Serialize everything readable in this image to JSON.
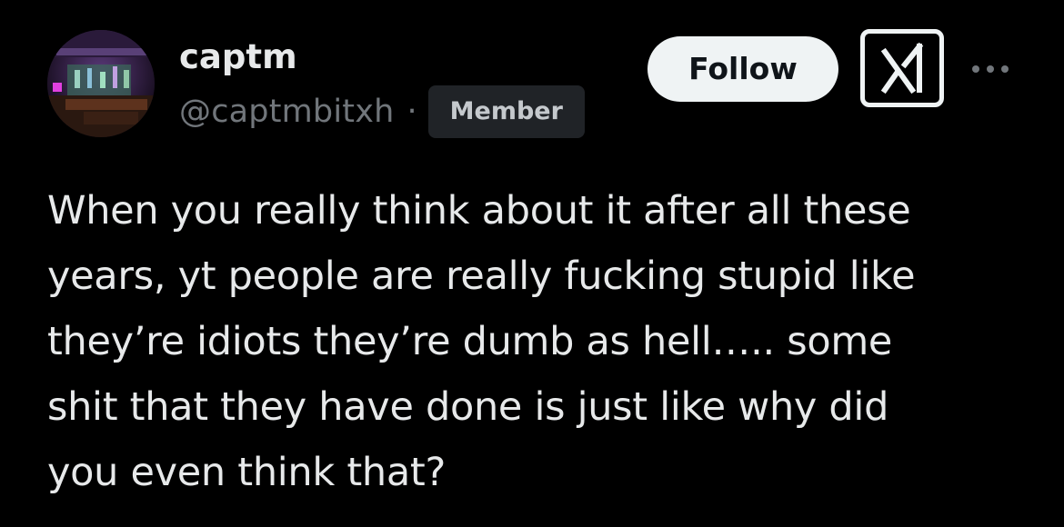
{
  "author": {
    "display_name": "captm",
    "handle": "@captmbitxh",
    "separator": "·",
    "badge": "Member",
    "avatar_icon": "avatar-photo-neon-room"
  },
  "actions": {
    "follow_label": "Follow",
    "grok_icon": "grok-icon",
    "more_icon": "more-icon"
  },
  "post": {
    "lines": [
      "When you really think about it after all these",
      "years, yt people are really fucking stupid like",
      "they’re idiots they’re dumb as hell….. some",
      "shit that they have done is just like why did",
      "you even think that?"
    ]
  },
  "colors": {
    "background": "#000000",
    "text_primary": "#e7e9ea",
    "text_secondary": "#71767b",
    "badge_bg": "#202327",
    "follow_bg": "#eff3f4",
    "follow_text": "#0f1419"
  }
}
